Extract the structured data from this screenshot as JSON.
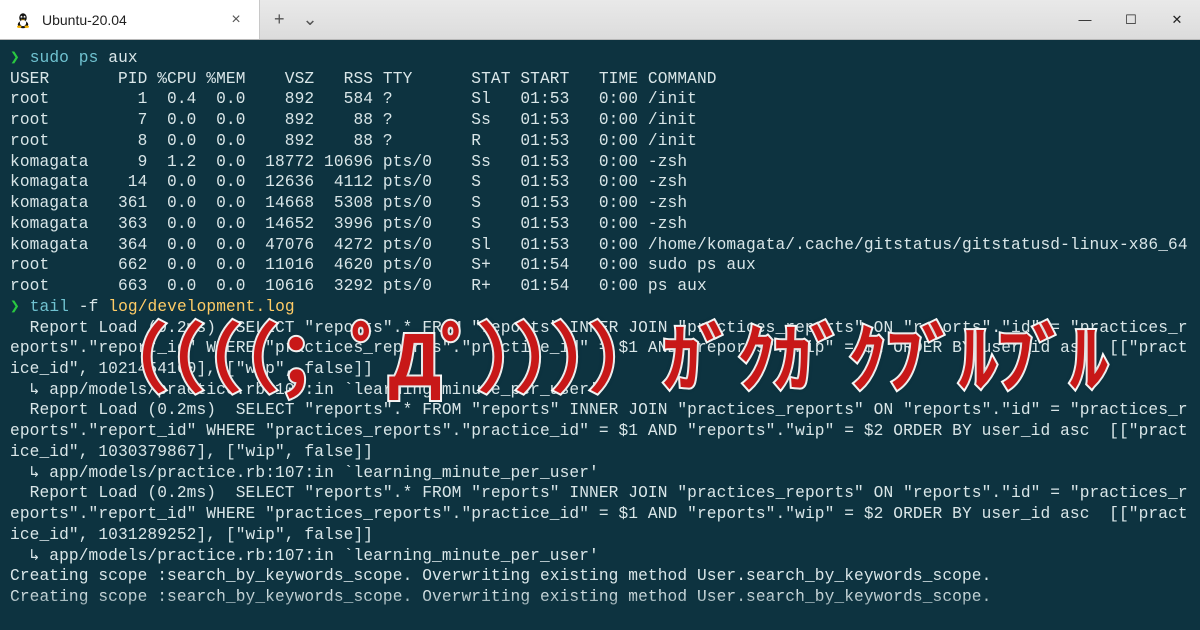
{
  "titlebar": {
    "tab_title": "Ubuntu-20.04",
    "new_tab_glyph": "+",
    "dropdown_glyph": "⌄",
    "close_glyph": "×",
    "min_glyph": "—",
    "max_glyph": "☐",
    "win_close_glyph": "✕"
  },
  "prompt1": {
    "symbol": "❯",
    "cmd": "sudo",
    "arg1": "ps",
    "arg2": "aux"
  },
  "prompt2": {
    "symbol": "❯",
    "cmd": "tail",
    "flag": "-f",
    "path": "log/development.log"
  },
  "ps_header": "USER       PID %CPU %MEM    VSZ   RSS TTY      STAT START   TIME COMMAND",
  "ps_rows": [
    "root         1  0.4  0.0    892   584 ?        Sl   01:53   0:00 /init",
    "root         7  0.0  0.0    892    88 ?        Ss   01:53   0:00 /init",
    "root         8  0.0  0.0    892    88 ?        R    01:53   0:00 /init",
    "komagata     9  1.2  0.0  18772 10696 pts/0    Ss   01:53   0:00 -zsh",
    "komagata    14  0.0  0.0  12636  4112 pts/0    S    01:53   0:00 -zsh",
    "komagata   361  0.0  0.0  14668  5308 pts/0    S    01:53   0:00 -zsh",
    "komagata   363  0.0  0.0  14652  3996 pts/0    S    01:53   0:00 -zsh",
    "komagata   364  0.0  0.0  47076  4272 pts/0    Sl   01:53   0:00 /home/komagata/.cache/gitstatus/gitstatusd-linux-x86_64",
    "root       662  0.0  0.0  11016  4620 pts/0    S+   01:54   0:00 sudo ps aux",
    "root       663  0.0  0.0  10616  3292 pts/0    R+   01:54   0:00 ps aux"
  ],
  "log_block": [
    "  Report Load (0.2ms)  SELECT \"reports\".* FROM \"reports\" INNER JOIN \"practices_reports\" ON \"reports\".\"id\" = \"practices_r",
    "eports\".\"report_id\" WHERE \"practices_reports\".\"practice_id\" = $1 AND \"reports\".\"wip\" = $2 ORDER BY user_id asc  [[\"pract",
    "ice_id\", 1021454160], [\"wip\", false]]",
    "  ↳ app/models/practice.rb:107:in `learning_minute_per_user'",
    "  Report Load (0.2ms)  SELECT \"reports\".* FROM \"reports\" INNER JOIN \"practices_reports\" ON \"reports\".\"id\" = \"practices_r",
    "eports\".\"report_id\" WHERE \"practices_reports\".\"practice_id\" = $1 AND \"reports\".\"wip\" = $2 ORDER BY user_id asc  [[\"pract",
    "ice_id\", 1030379867], [\"wip\", false]]",
    "  ↳ app/models/practice.rb:107:in `learning_minute_per_user'",
    "  Report Load (0.2ms)  SELECT \"reports\".* FROM \"reports\" INNER JOIN \"practices_reports\" ON \"reports\".\"id\" = \"practices_r",
    "eports\".\"report_id\" WHERE \"practices_reports\".\"practice_id\" = $1 AND \"reports\".\"wip\" = $2 ORDER BY user_id asc  [[\"pract",
    "ice_id\", 1031289252], [\"wip\", false]]",
    "  ↳ app/models/practice.rb:107:in `learning_minute_per_user'",
    "Creating scope :search_by_keywords_scope. Overwriting existing method User.search_by_keywords_scope.",
    "Creating scope :search_by_keywords_scope. Overwriting existing method User.search_by_keywords_scope."
  ],
  "overlay": "（（（（；ﾟДﾟ））））ｶﾞｸｶﾞｸﾌﾞﾙﾌﾞﾙ"
}
